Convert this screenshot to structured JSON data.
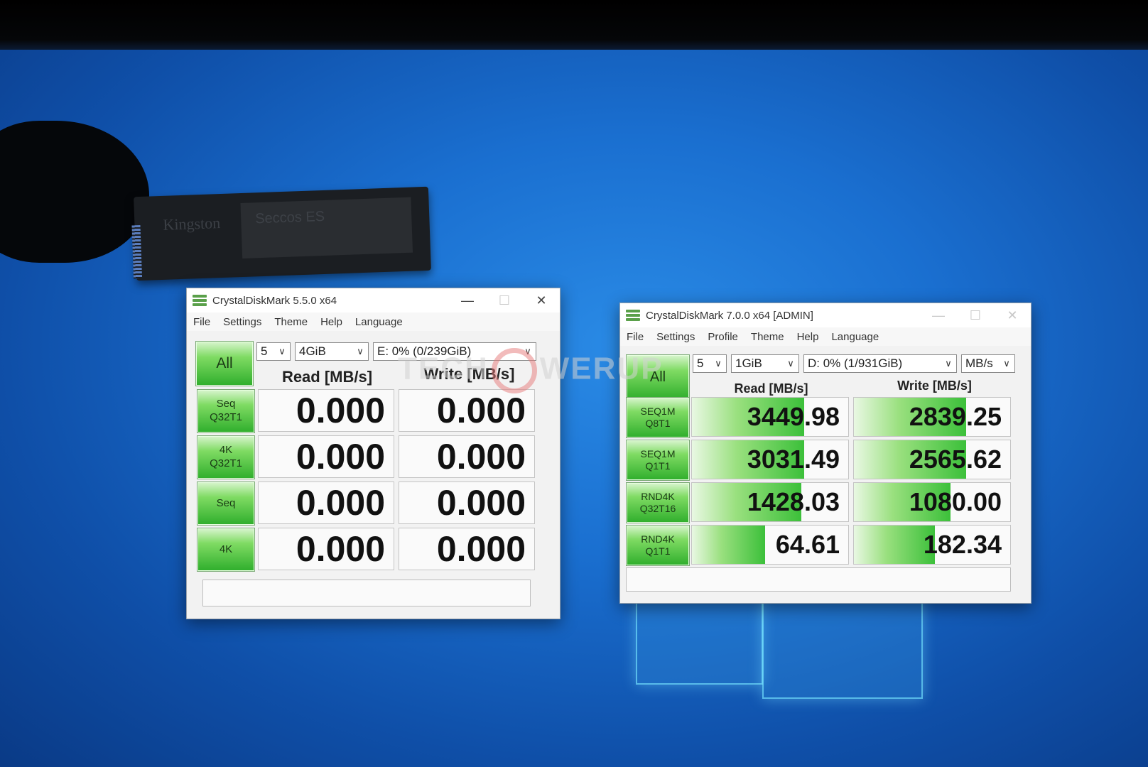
{
  "ssd": {
    "brand": "Kingston",
    "label": "Seccos ES"
  },
  "watermark": {
    "text_left": "TECH",
    "text_right": "WERUP"
  },
  "win1": {
    "title": "CrystalDiskMark 5.5.0 x64",
    "menu": [
      "File",
      "Settings",
      "Theme",
      "Help",
      "Language"
    ],
    "all_label": "All",
    "count": "5",
    "size": "4GiB",
    "drive": "E: 0% (0/239GiB)",
    "read_header": "Read [MB/s]",
    "write_header": "Write [MB/s]",
    "rows": [
      {
        "label1": "Seq",
        "label2": "Q32T1",
        "read": "0.000",
        "write": "0.000",
        "read_frac": 0,
        "write_frac": 0
      },
      {
        "label1": "4K",
        "label2": "Q32T1",
        "read": "0.000",
        "write": "0.000",
        "read_frac": 0,
        "write_frac": 0
      },
      {
        "label1": "Seq",
        "label2": "",
        "read": "0.000",
        "write": "0.000",
        "read_frac": 0,
        "write_frac": 0
      },
      {
        "label1": "4K",
        "label2": "",
        "read": "0.000",
        "write": "0.000",
        "read_frac": 0,
        "write_frac": 0
      }
    ]
  },
  "win2": {
    "title": "CrystalDiskMark 7.0.0 x64 [ADMIN]",
    "menu": [
      "File",
      "Settings",
      "Profile",
      "Theme",
      "Help",
      "Language"
    ],
    "all_label": "All",
    "count": "5",
    "size": "1GiB",
    "drive": "D: 0% (1/931GiB)",
    "unit": "MB/s",
    "read_header": "Read [MB/s]",
    "write_header": "Write [MB/s]",
    "rows": [
      {
        "label1": "SEQ1M",
        "label2": "Q8T1",
        "read": "3449.98",
        "write": "2839.25",
        "read_frac": 0.72,
        "write_frac": 0.72
      },
      {
        "label1": "SEQ1M",
        "label2": "Q1T1",
        "read": "3031.49",
        "write": "2565.62",
        "read_frac": 0.72,
        "write_frac": 0.72
      },
      {
        "label1": "RND4K",
        "label2": "Q32T16",
        "read": "1428.03",
        "write": "1080.00",
        "read_frac": 0.7,
        "write_frac": 0.62
      },
      {
        "label1": "RND4K",
        "label2": "Q1T1",
        "read": "64.61",
        "write": "182.34",
        "read_frac": 0.47,
        "write_frac": 0.52
      }
    ]
  },
  "colors": {
    "accent_green": "#2fae2c",
    "desktop_blue": "#1a6fd0"
  }
}
